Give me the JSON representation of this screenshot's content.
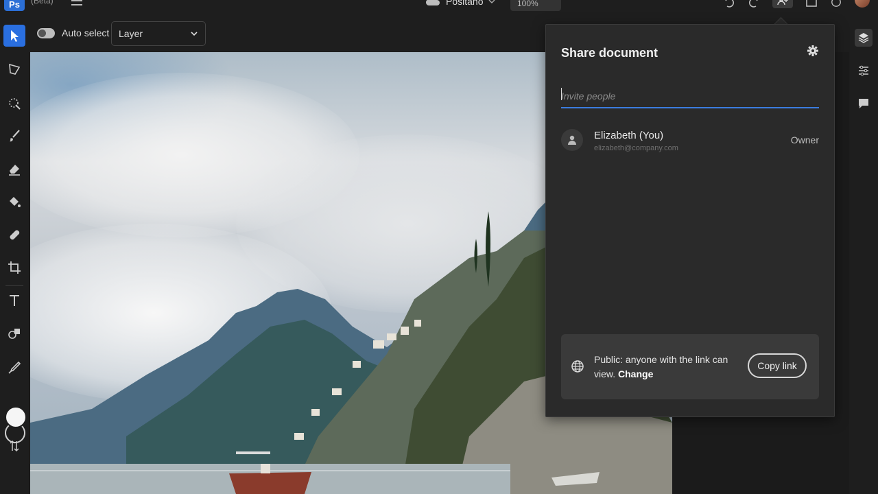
{
  "app": {
    "logo": "Ps",
    "beta_label": "(Beta)",
    "document_title": "Positano",
    "zoom": "100%"
  },
  "options_bar": {
    "auto_select_label": "Auto select",
    "auto_select_on": true,
    "layer_select_value": "Layer"
  },
  "toolbar": {
    "tools": [
      "move-icon",
      "lasso-icon",
      "quick-select-icon",
      "brush-icon",
      "eraser-icon",
      "paint-bucket-icon",
      "healing-icon",
      "crop-icon",
      "type-icon",
      "shapes-icon",
      "eyedropper-icon"
    ],
    "foreground_color": "#f5f5f5",
    "background_color": "#1e1e1e",
    "active_color": "#2a6fe0"
  },
  "share": {
    "title": "Share document",
    "invite_placeholder": "Invite people",
    "people": [
      {
        "name": "Elizabeth (You)",
        "email": "elizabeth@company.com",
        "role": "Owner"
      }
    ],
    "public_text": "Public: anyone with the link can view.",
    "change_label": "Change",
    "copy_link_label": "Copy link",
    "accent_color": "#3b7de0"
  },
  "right_panel": {
    "icons": [
      "layers-icon",
      "adjustments-icon",
      "comments-icon"
    ]
  }
}
